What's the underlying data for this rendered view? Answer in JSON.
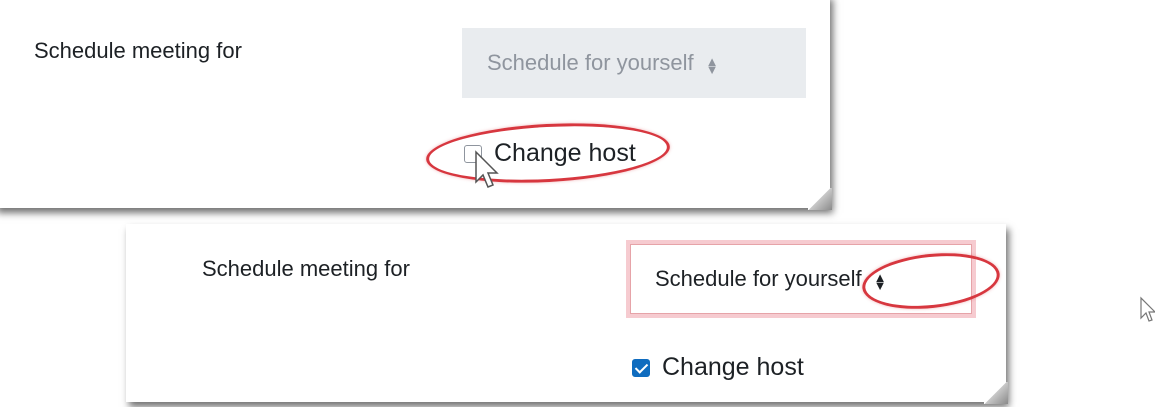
{
  "top_panel": {
    "label": "Schedule meeting for",
    "select_value": "Schedule for yourself",
    "checkbox_label": "Change host",
    "checkbox_checked": false
  },
  "bottom_panel": {
    "label": "Schedule meeting for",
    "select_value": "Schedule for yourself",
    "checkbox_label": "Change host",
    "checkbox_checked": true
  },
  "icons": {
    "select_arrows": "updown-arrows-icon",
    "cursor": "mouse-pointer-icon",
    "highlight": "red-ellipse-annotation"
  },
  "colors": {
    "checkbox_checked": "#0f6cbf",
    "annotation": "#d7373f",
    "disabled_select_bg": "#e9ecef"
  }
}
